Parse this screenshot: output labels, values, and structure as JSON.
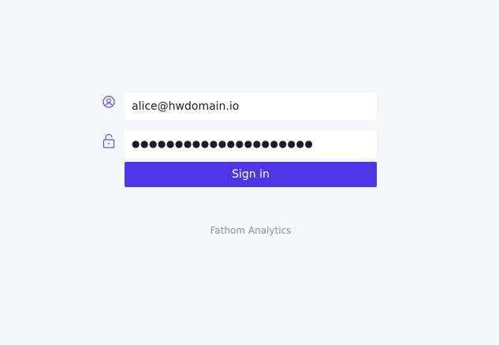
{
  "login": {
    "email_value": "alice@hwdomain.io",
    "password_masked": "●●●●●●●●●●●●●●●●●●●●●",
    "sign_in_label": "Sign in"
  },
  "brand": {
    "name": "Fathom Analytics"
  },
  "icons": {
    "user": "user-circle-icon",
    "lock": "lock-icon"
  },
  "colors": {
    "background": "#f6f7fb",
    "accent": "#4f35e6",
    "icon": "#5f4fe6",
    "muted_text": "#8e9099"
  }
}
